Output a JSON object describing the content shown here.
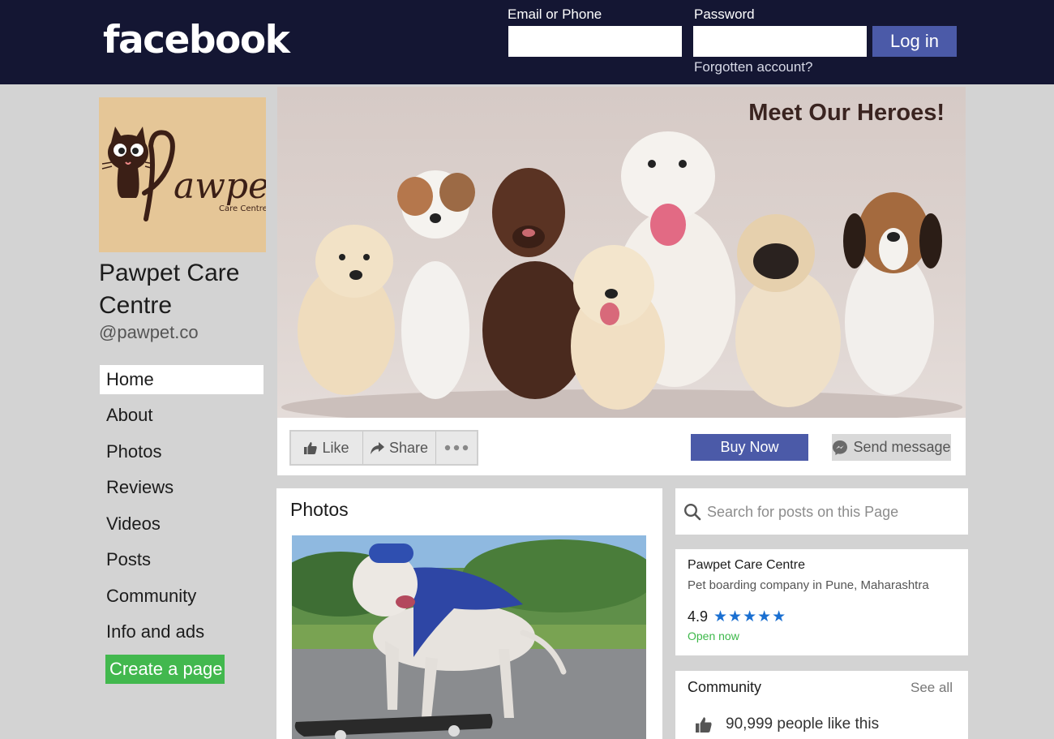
{
  "header": {
    "logo": "facebook",
    "email_label": "Email or Phone",
    "password_label": "Password",
    "login_label": "Log in",
    "forgot_label": "Forgotten account?"
  },
  "sidebar": {
    "page_name": "Pawpet Care Centre",
    "handle": "@pawpet.co",
    "logo_text": "awpet",
    "logo_sub": "Care Centre",
    "nav": [
      {
        "label": "Home",
        "active": true
      },
      {
        "label": "About"
      },
      {
        "label": "Photos"
      },
      {
        "label": "Reviews"
      },
      {
        "label": "Videos"
      },
      {
        "label": "Posts"
      },
      {
        "label": "Community"
      },
      {
        "label": "Info and ads"
      }
    ],
    "create_page_label": "Create a page"
  },
  "cover": {
    "title": "Meet Our Heroes!"
  },
  "actions": {
    "like": "Like",
    "share": "Share",
    "buy_now": "Buy Now",
    "send_message": "Send message"
  },
  "photos": {
    "title": "Photos"
  },
  "search": {
    "placeholder": "Search for posts on this Page"
  },
  "info": {
    "name": "Pawpet Care Centre",
    "description": "Pet boarding company in Pune, Maharashtra",
    "rating": "4.9",
    "stars": 5,
    "status": "Open now"
  },
  "community": {
    "title": "Community",
    "see_all": "See all",
    "likes": "90,999 people like this"
  },
  "colors": {
    "header_bg": "#141633",
    "brand_blue": "#4b5aa8",
    "create_green": "#42b84e",
    "star_blue": "#1a6fd1",
    "open_green": "#3db84a"
  }
}
